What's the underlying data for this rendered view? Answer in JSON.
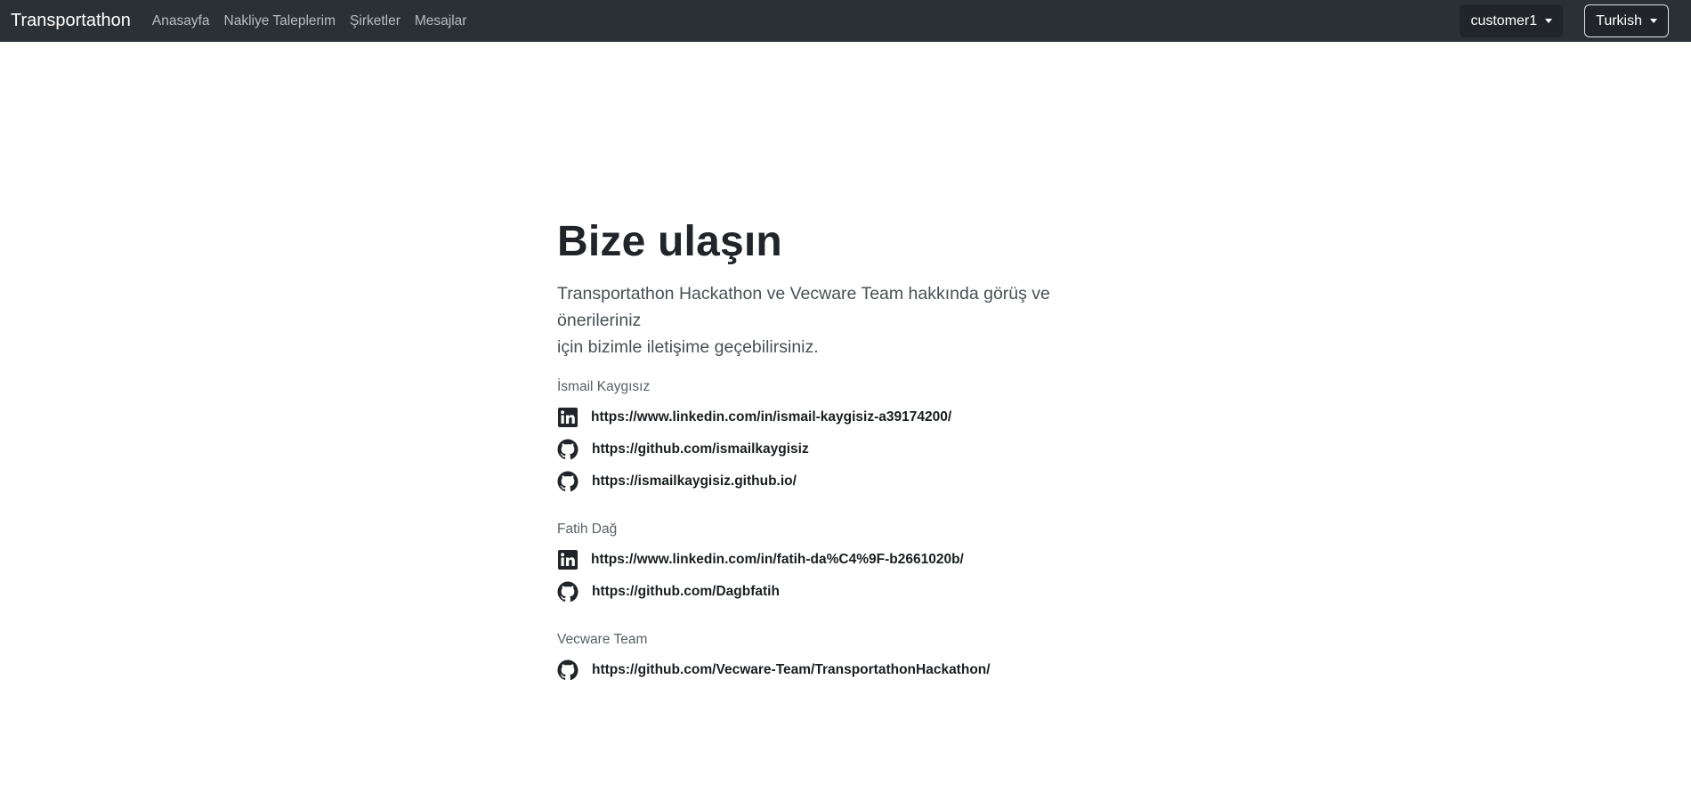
{
  "navbar": {
    "brand": "Transportathon",
    "links": [
      "Anasayfa",
      "Nakliye Taleplerim",
      "Şirketler",
      "Mesajlar"
    ],
    "user_label": "customer1",
    "language_label": "Turkish"
  },
  "main": {
    "title": "Bize ulaşın",
    "lead_line1": "Transportathon Hackathon ve Vecware Team hakkında görüş ve önerileriniz",
    "lead_line2": "için bizimle iletişime geçebilirsiniz.",
    "contacts": [
      {
        "name": "İsmail Kaygısız",
        "links": [
          {
            "icon": "linkedin-icon",
            "url": "https://www.linkedin.com/in/ismail-kaygisiz-a39174200/"
          },
          {
            "icon": "github-icon",
            "url": "https://github.com/ismailkaygisiz"
          },
          {
            "icon": "github-icon",
            "url": "https://ismailkaygisiz.github.io/"
          }
        ]
      },
      {
        "name": "Fatih Dağ",
        "links": [
          {
            "icon": "linkedin-icon",
            "url": "https://www.linkedin.com/in/fatih-da%C4%9F-b2661020b/"
          },
          {
            "icon": "github-icon",
            "url": "https://github.com/Dagbfatih"
          }
        ]
      },
      {
        "name": "Vecware Team",
        "links": [
          {
            "icon": "github-icon",
            "url": "https://github.com/Vecware-Team/TransportathonHackathon/"
          }
        ]
      }
    ]
  },
  "colors": {
    "navbar_bg": "#2b3035",
    "nav_link": "#b9bdc1",
    "text_dark": "#212529"
  }
}
